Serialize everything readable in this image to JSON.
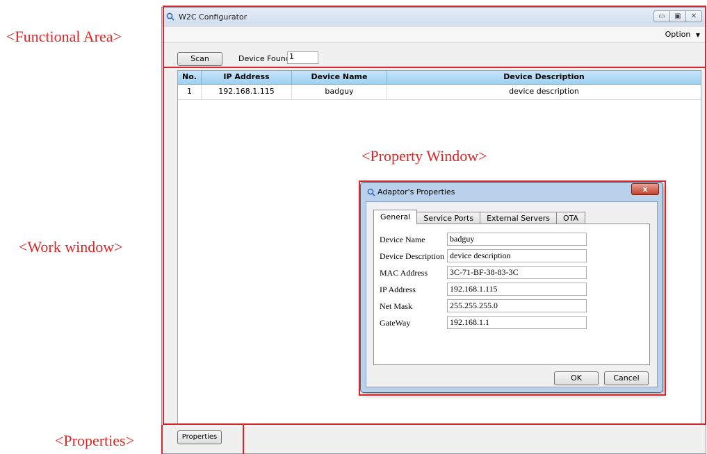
{
  "annotations": {
    "functional_area": "<Functional Area>",
    "work_window": "<Work window>",
    "properties": "<Properties>",
    "property_window": "<Property Window>"
  },
  "window": {
    "title": "W2C Configurator",
    "caption_buttons": [
      "minimize-icon",
      "maximize-icon",
      "close-icon"
    ]
  },
  "menu": {
    "option_label": "Option",
    "option_arrow": "▼"
  },
  "toolbar": {
    "scan_label": "Scan",
    "device_found_label": "Device Found",
    "device_found_value": "1"
  },
  "table": {
    "columns": [
      "No.",
      "IP Address",
      "Device Name",
      "Device Description"
    ],
    "rows": [
      {
        "no": "1",
        "ip": "192.168.1.115",
        "name": "badguy",
        "description": "device description"
      }
    ]
  },
  "footer": {
    "properties_label": "Properties"
  },
  "dialog": {
    "title": "Adaptor's Properties",
    "close_glyph": "x",
    "tabs": [
      "General",
      "Service Ports",
      "External Servers",
      "OTA"
    ],
    "active_tab": "General",
    "fields": [
      {
        "label": "Device Name",
        "value": "badguy"
      },
      {
        "label": "Device Description",
        "value": "device description"
      },
      {
        "label": "MAC Address",
        "value": "3C-71-BF-38-83-3C"
      },
      {
        "label": "IP Address",
        "value": "192.168.1.115"
      },
      {
        "label": "Net Mask",
        "value": "255.255.255.0"
      },
      {
        "label": "GateWay",
        "value": "192.168.1.1"
      }
    ],
    "ok_label": "OK",
    "cancel_label": "Cancel"
  },
  "colors": {
    "annotation_red": "#d8262b",
    "header_blue": "#9dd0f2",
    "dialog_frame": "#b9d1ea"
  }
}
